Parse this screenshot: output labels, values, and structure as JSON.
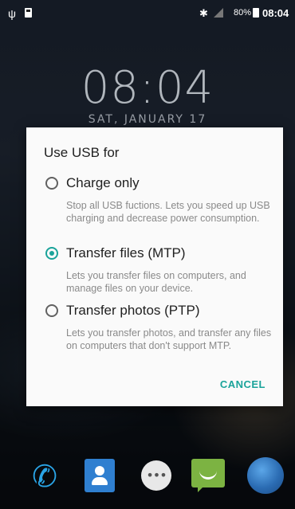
{
  "status_bar": {
    "battery_percent": "80%",
    "time": "08:04"
  },
  "lock_screen": {
    "clock": "08:04",
    "date": "SAT, JANUARY 17"
  },
  "dialog": {
    "title": "Use USB for",
    "options": [
      {
        "label": "Charge only",
        "description": "Stop all USB fuctions. Lets you speed up USB charging and decrease power consumption.",
        "selected": false
      },
      {
        "label": "Transfer files (MTP)",
        "description": "Lets you transfer files on computers, and manage files on your device.",
        "selected": true
      },
      {
        "label": "Transfer photos (PTP)",
        "description": "Lets you transfer photos, and transfer any files on computers that don't support MTP.",
        "selected": false
      }
    ],
    "cancel_label": "CANCEL"
  },
  "dock": {
    "items": [
      "phone-icon",
      "contacts-icon",
      "apps-icon",
      "messages-icon",
      "browser-icon"
    ]
  },
  "colors": {
    "accent": "#1aa39a",
    "dialog_bg": "#fafafa"
  }
}
